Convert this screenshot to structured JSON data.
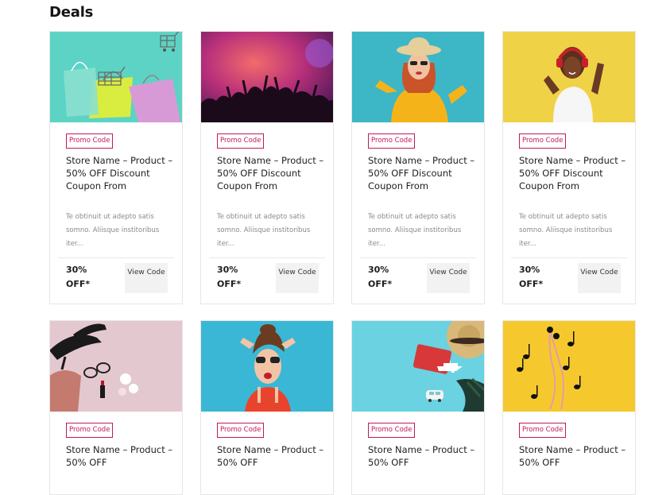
{
  "section": {
    "title": "Deals"
  },
  "colors": {
    "accent": "#c2185b",
    "button_bg": "#f2f2f2",
    "text_muted": "#8a8a8a"
  },
  "deals": [
    {
      "image": "shopping-bags-cart-image",
      "badge": "Promo Code",
      "name": "Store Name – Product – 50% OFF Discount Coupon From",
      "description": "Te obtinuit ut adepto satis somno. Aliisque institoribus iter...",
      "discount": "30% OFF*",
      "button": "View Code"
    },
    {
      "image": "concert-crowd-image",
      "badge": "Promo Code",
      "name": "Store Name – Product – 50% OFF Discount Coupon From",
      "description": "Te obtinuit ut adepto satis somno. Aliisque institoribus iter...",
      "discount": "30% OFF*",
      "button": "View Code"
    },
    {
      "image": "woman-yellow-sweater-image",
      "badge": "Promo Code",
      "name": "Store Name – Product – 50% OFF Discount Coupon From",
      "description": "Te obtinuit ut adepto satis somno. Aliisque institoribus iter...",
      "discount": "30% OFF*",
      "button": "View Code"
    },
    {
      "image": "woman-headphones-image",
      "badge": "Promo Code",
      "name": "Store Name – Product – 50% OFF Discount Coupon From",
      "description": "Te obtinuit ut adepto satis somno. Aliisque institoribus iter...",
      "discount": "30% OFF*",
      "button": "View Code"
    },
    {
      "image": "fashion-accessories-image",
      "badge": "Promo Code",
      "name": "Store Name – Product – 50% OFF",
      "description": "",
      "discount": "",
      "button": ""
    },
    {
      "image": "woman-sunglasses-image",
      "badge": "Promo Code",
      "name": "Store Name – Product – 50% OFF",
      "description": "",
      "discount": "",
      "button": ""
    },
    {
      "image": "travel-passport-image",
      "badge": "Promo Code",
      "name": "Store Name – Product – 50% OFF",
      "description": "",
      "discount": "",
      "button": ""
    },
    {
      "image": "earphones-music-notes-image",
      "badge": "Promo Code",
      "name": "Store Name – Product – 50% OFF",
      "description": "",
      "discount": "",
      "button": ""
    }
  ]
}
